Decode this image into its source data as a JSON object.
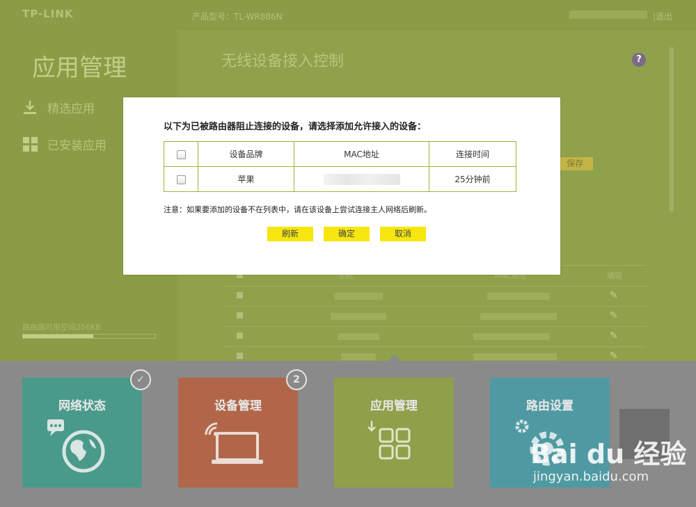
{
  "header": {
    "logo": "TP-LINK",
    "model": "产品型号：TL-WR886N",
    "logout": "退出"
  },
  "sidebar": {
    "title": "应用管理",
    "items": [
      {
        "label": "精选应用",
        "icon": "download-icon"
      },
      {
        "label": "已安装应用",
        "icon": "apps-grid-icon"
      }
    ],
    "storage_label": "路由器可用空间256KB",
    "storage_used_fraction": 0.53
  },
  "main": {
    "title": "无线设备接入控制",
    "save_label": "保存",
    "list_headers": [
      "主机",
      "MAC地址",
      "编辑"
    ],
    "list_rows": 4
  },
  "modal": {
    "title": "以下为已被路由器阻止连接的设备，请选择添加允许接入的设备：",
    "columns": [
      "设备品牌",
      "MAC地址",
      "连接时间"
    ],
    "rows": [
      {
        "brand": "苹果",
        "mac": "",
        "time": "25分钟前"
      }
    ],
    "note": "注意：如果要添加的设备不在列表中，请在该设备上尝试连接主人网络后刷新。",
    "buttons": {
      "refresh": "刷新",
      "confirm": "确定",
      "cancel": "取消"
    }
  },
  "tiles": [
    {
      "label": "网络状态",
      "color": "#4a9a8c",
      "badge": "✓"
    },
    {
      "label": "设备管理",
      "color": "#b1664a",
      "badge": "2"
    },
    {
      "label": "应用管理",
      "color": "#8fa04a",
      "badge": ""
    },
    {
      "label": "路由设置",
      "color": "#4f9aa2",
      "badge": ""
    }
  ],
  "watermark": {
    "brand": "Bai du 经验",
    "url": "jingyan.baidu.com"
  },
  "colors": {
    "accent_yellow": "#f6e60e",
    "table_border": "#9ab33c",
    "overlay_green": "#8fa04a"
  }
}
